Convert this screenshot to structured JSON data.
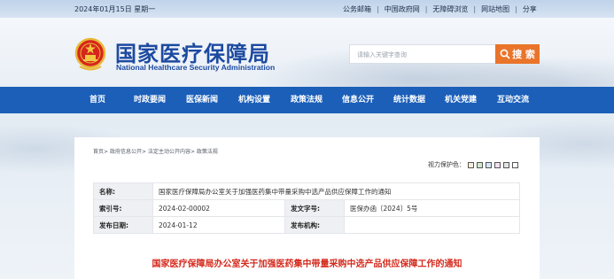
{
  "topbar": {
    "date": "2024年01月15日 星期一",
    "links": [
      "公务邮箱",
      "中国政府网",
      "无障碍浏览",
      "网站地图",
      "分享"
    ]
  },
  "header": {
    "title": "国家医疗保障局",
    "subtitle": "National Healthcare Security Administration",
    "emblem_icon": "national-emblem-icon",
    "search": {
      "placeholder": "请输入关键字查询",
      "button_label": "搜 索",
      "button_icon": "search-icon"
    }
  },
  "nav": {
    "items": [
      "首页",
      "时政要闻",
      "医保新闻",
      "机构设置",
      "政策法规",
      "信息公开",
      "统计数据",
      "机关党建",
      "互动交流"
    ]
  },
  "breadcrumb": {
    "items": [
      "首页",
      "政府信息公开",
      "法定主动公开内容",
      "政策法规"
    ],
    "separator": ">"
  },
  "eye_care": {
    "label": "视力保护色：",
    "colors": [
      "#f5eedc",
      "#cfe8cf",
      "#d6e6f5",
      "#f0e0f0",
      "#e4e4e4",
      "#ffffff"
    ]
  },
  "info": {
    "name_label": "名称:",
    "name_value": "国家医疗保障局办公室关于加强医药集中带量采购中选产品供应保障工作的通知",
    "index_label": "索引号:",
    "index_value": "2024-02-00002",
    "docno_label": "发文字号:",
    "docno_value": "医保办函〔2024〕5号",
    "date_label": "发布日期:",
    "date_value": "2024-01-12",
    "org_label": "发布机构:",
    "org_value": ""
  },
  "article": {
    "title": "国家医疗保障局办公室关于加强医药集中带量采购中选产品供应保障工作的通知"
  },
  "colors": {
    "nav_blue": "#1b5fb9",
    "brand_blue": "#1d4aa0",
    "search_orange": "#e9742a",
    "title_red": "#d52b1e"
  }
}
